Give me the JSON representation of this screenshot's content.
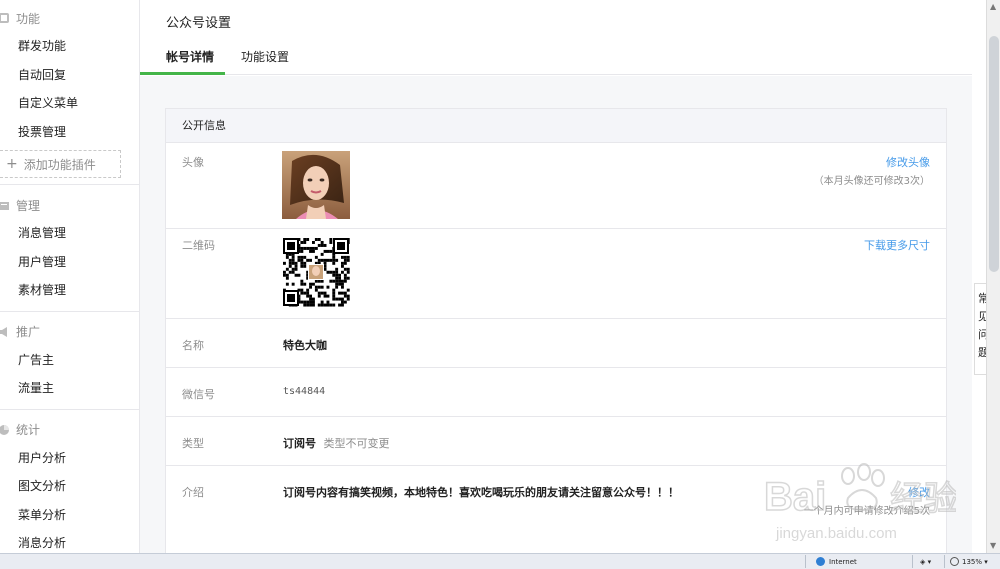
{
  "sidebar": {
    "sections": [
      {
        "title": "功能",
        "icon": "function-icon"
      },
      {
        "title": "管理",
        "icon": "manage-icon"
      },
      {
        "title": "推广",
        "icon": "promote-icon"
      },
      {
        "title": "统计",
        "icon": "stats-icon"
      }
    ],
    "function_items": [
      "群发功能",
      "自动回复",
      "自定义菜单",
      "投票管理"
    ],
    "add_plugin": "添加功能插件",
    "manage_items": [
      "消息管理",
      "用户管理",
      "素材管理"
    ],
    "promote_items": [
      "广告主",
      "流量主"
    ],
    "stats_items": [
      "用户分析",
      "图文分析",
      "菜单分析",
      "消息分析"
    ]
  },
  "header": {
    "title": "公众号设置",
    "tabs": [
      "帐号详情",
      "功能设置"
    ],
    "active_tab": "帐号详情"
  },
  "panel": {
    "title": "公开信息",
    "avatar": {
      "label": "头像",
      "link": "修改头像",
      "note": "（本月头像还可修改3次）"
    },
    "qrcode": {
      "label": "二维码",
      "link": "下载更多尺寸"
    },
    "name": {
      "label": "名称",
      "value": "特色大咖"
    },
    "wechat_id": {
      "label": "微信号",
      "value": "ts44844"
    },
    "type": {
      "label": "类型",
      "value": "订阅号",
      "note": "类型不可变更"
    },
    "intro": {
      "label": "介绍",
      "value": "订阅号内容有搞笑视频，本地特色！喜欢吃喝玩乐的朋友请关注留意公众号！！！",
      "link": "修改",
      "note": "一个月内可申请修改介绍5次"
    }
  },
  "float_tab": {
    "chars": [
      "常",
      "见",
      "问",
      "题"
    ]
  },
  "statusbar": {
    "zone": "Internet",
    "zoom": "135%"
  },
  "watermark": {
    "brand": "Baidu经验",
    "url": "jingyan.baidu.com"
  },
  "colors": {
    "accent_green": "#44b549",
    "link_blue": "#459ae9"
  }
}
